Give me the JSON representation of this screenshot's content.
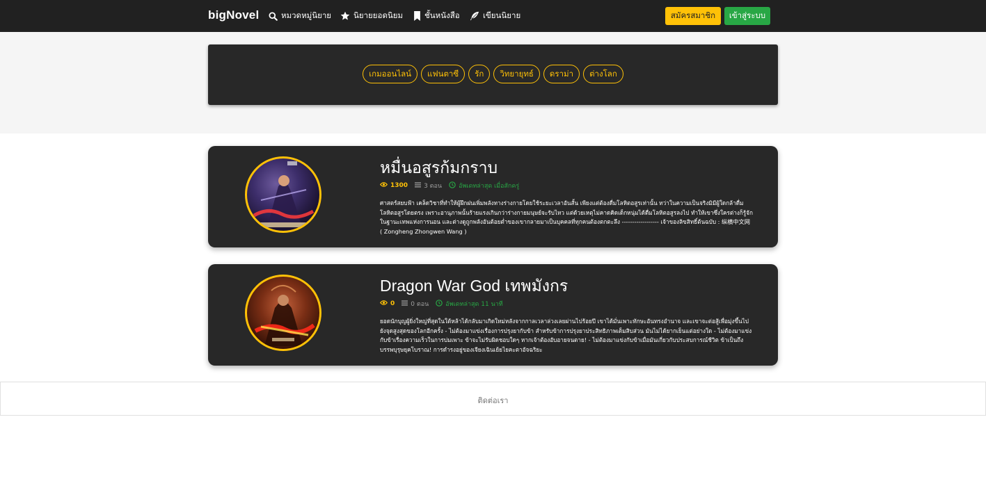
{
  "navbar": {
    "brand": "bigNovel",
    "links": [
      {
        "label": "หมวดหมู่นิยาย",
        "icon": "search-icon"
      },
      {
        "label": "นิยายยอดนิยม",
        "icon": "star-icon"
      },
      {
        "label": "ชั้นหนังสือ",
        "icon": "bookmark-icon"
      },
      {
        "label": "เขียนนิยาย",
        "icon": "feather-icon"
      }
    ],
    "signup_label": "สมัครสมาชิก",
    "login_label": "เข้าสู่ระบบ"
  },
  "genres": [
    "เกมออนไลน์",
    "แฟนตาซี",
    "รัก",
    "วิทยายุทธ์",
    "ดราม่า",
    "ต่างโลก"
  ],
  "novels": [
    {
      "title": "หมื่นอสูรก้มกราบ",
      "views": "1300",
      "episodes": "3 ตอน",
      "updated": "อัพเดทล่าสุด เมื่อสักครู่",
      "description": "ศาสตร์สยบฟ้า เคล็ดวิชาที่ทำให้ผู้ฝึกฝนเพิ่มพลังทางร่างกายโดยใช้ระยะเวลาอันสั้น เพียงแต่ต้องดื่มโลหิตอสูรเท่านั้น ทว่าในความเป็นจริงมิมีผู้ใดกล้าดื่มโลหิตอสูรโดยตรง เพราะอานุภาพนั้นร้ายแรงเกินกว่าร่างกายมนุษย์จะรับไหว แต่ด้วยเหตุไม่คาดคิดเด็กหนุ่มได้ดื่มโลหิตอสูรลงไป ทำให้เขาซึ่งใครต่างก็รู้จักในฐานะเทพแห่งการนอน และต่างดูถูกพลังอันต้อยต่ำของเขากลายมาเป็นบุคคลที่ทุกคนต้องตกตะลึง ------------------ เจ้าของลิขสิทธิ์ต้นฉบับ : 纵横中文网 ( Zongheng Zhongwen Wang )",
      "cover": "cover-1"
    },
    {
      "title": "Dragon War God เทพมังกร",
      "views": "0",
      "episodes": "0 ตอน",
      "updated": "อัพเดทล่าสุด 11 นาที",
      "description": "ยอดนักบุญผู้ยิ่งใหญ่ที่สุดในใต้หล้าได้กลับมาเกิดใหม่หลังจากกาลเวลาล่วงเลยผ่านไปร้อยปี เขาได้มั่นเพาะทักษะอันทรงอำนาจ และเขาจะต่อสู้เพื่อมุ่งขึ้นไปยังจุดสูงสุดของโลกอีกครั้ง - ไม่ต้องมาแข่งเรื่องการปรุงยากับข้า สำหรับข้าการปรุงยาประสิทธิภาพเต็มสิบส่วน มันไม่ได้ยากเย็นแต่อย่างใด - ไม่ต้องมาแข่งกับข้าเรื่องความเร็วในการบ่มเพาะ ข้าจะไม่รับผิดชอบใดๆ หากเจ้าต้องอับอายจนตาย! - ไม่ต้องมาแข่งกับข้าเมื่อมันเกี่ยวกับประสบการณ์ชีวิต ข้าเป็นถึงบรรพบุรุษยุคโบราณ! การดำรงอยู่ของเจียงเฉินเย้ยไยคะตาอัจฉริยะ",
      "cover": "cover-2"
    }
  ],
  "footer": {
    "contact_label": "ติดต่อเรา"
  },
  "colors": {
    "navbar": "#212121",
    "card": "#282828",
    "accent": "#ffc107",
    "success": "#28a745"
  }
}
